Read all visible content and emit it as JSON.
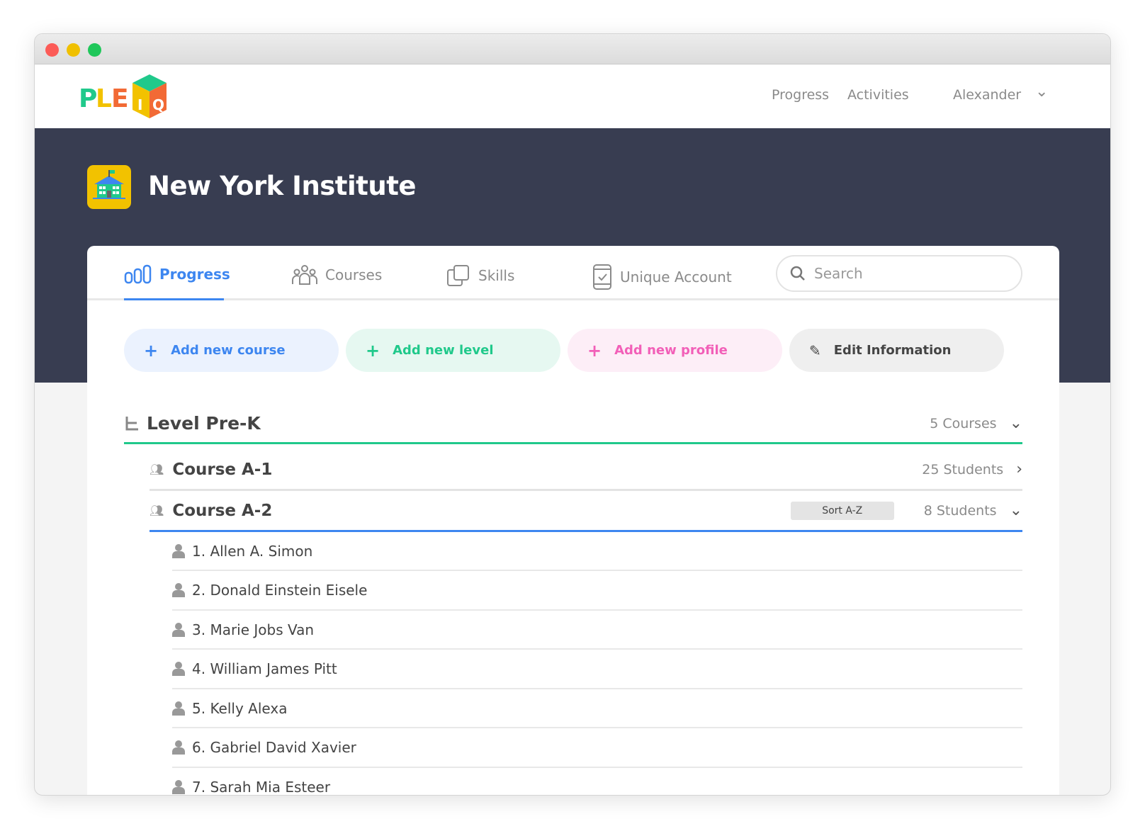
{
  "window": {
    "controls": [
      "close",
      "minimize",
      "maximize"
    ]
  },
  "brand": {
    "logo_text": "PLEIQ"
  },
  "nav": {
    "progress": "Progress",
    "activities": "Activities",
    "user": "Alexander"
  },
  "institution": {
    "name": "New York Institute",
    "icon": "school-icon"
  },
  "tabs": [
    {
      "label": "Progress",
      "icon": "bar-chart-icon",
      "active": true
    },
    {
      "label": "Courses",
      "icon": "group-icon"
    },
    {
      "label": "Skills",
      "icon": "copy-icon"
    },
    {
      "label": "Unique Account",
      "icon": "phone-check-icon"
    }
  ],
  "search": {
    "placeholder": "Search",
    "value": ""
  },
  "actions": {
    "add_course": "Add new course",
    "add_level": "Add new level",
    "add_profile": "Add new profile",
    "edit_info": "Edit Information"
  },
  "colors": {
    "blue": "#3d86f0",
    "green": "#20c98b",
    "pink": "#f25fb8",
    "dark": "#383d51"
  },
  "level": {
    "name": "Level Pre-K",
    "count": "5 Courses"
  },
  "courses": [
    {
      "name": "Course A-1",
      "count": "25 Students"
    },
    {
      "name": "Course A-2",
      "count": "8 Students",
      "sort_label": "Sort A-Z"
    }
  ],
  "students": [
    "1. Allen A. Simon",
    "2. Donald Einstein Eisele",
    "3. Marie Jobs Van",
    "4. William James Pitt",
    "5. Kelly Alexa",
    "6. Gabriel David Xavier",
    "7. Sarah Mia Esteer"
  ]
}
